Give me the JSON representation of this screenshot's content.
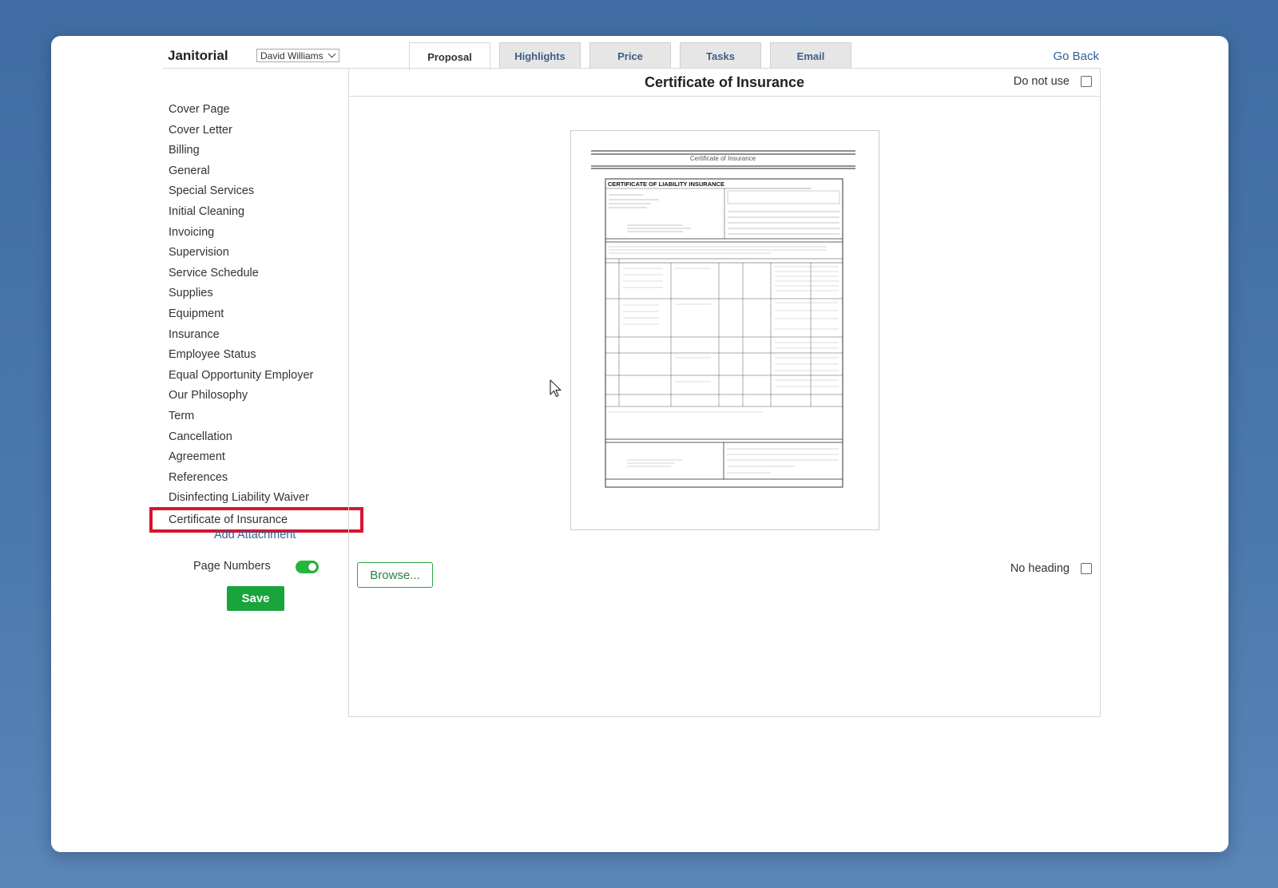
{
  "header": {
    "app_title": "Janitorial",
    "user_select_value": "David Williams",
    "go_back": "Go Back"
  },
  "tabs": [
    {
      "label": "Proposal",
      "active": true
    },
    {
      "label": "Highlights",
      "active": false
    },
    {
      "label": "Price",
      "active": false
    },
    {
      "label": "Tasks",
      "active": false
    },
    {
      "label": "Email",
      "active": false
    }
  ],
  "sidebar": {
    "items": [
      {
        "label": "Cover Page"
      },
      {
        "label": "Cover Letter"
      },
      {
        "label": "Billing"
      },
      {
        "label": "General"
      },
      {
        "label": "Special Services"
      },
      {
        "label": "Initial Cleaning"
      },
      {
        "label": "Invoicing"
      },
      {
        "label": "Supervision"
      },
      {
        "label": "Service Schedule"
      },
      {
        "label": "Supplies"
      },
      {
        "label": "Equipment"
      },
      {
        "label": "Insurance"
      },
      {
        "label": "Employee Status"
      },
      {
        "label": "Equal Opportunity Employer"
      },
      {
        "label": "Our Philosophy"
      },
      {
        "label": "Term"
      },
      {
        "label": "Cancellation"
      },
      {
        "label": "Agreement"
      },
      {
        "label": "References"
      },
      {
        "label": "Disinfecting Liability Waiver"
      },
      {
        "label": "Certificate of Insurance"
      }
    ],
    "selected_index": 20,
    "add_attachment": "Add Attachment",
    "page_numbers_label": "Page Numbers",
    "page_numbers_on": true,
    "save_label": "Save"
  },
  "main": {
    "title": "Certificate of Insurance",
    "do_not_use_label": "Do not use",
    "do_not_use_checked": false,
    "preview": {
      "doc_heading": "Certificate of Insurance",
      "form_title": "CERTIFICATE OF LIABILITY INSURANCE"
    },
    "browse_label": "Browse...",
    "no_heading_label": "No heading",
    "no_heading_checked": false
  },
  "colors": {
    "background": "#4a79ad",
    "accent_green": "#17a53c",
    "link_blue": "#2f5f96",
    "highlight_red": "#d6152e"
  },
  "icons": {
    "select_chevron": "chevron-down-icon",
    "cursor": "mouse-pointer-icon"
  }
}
